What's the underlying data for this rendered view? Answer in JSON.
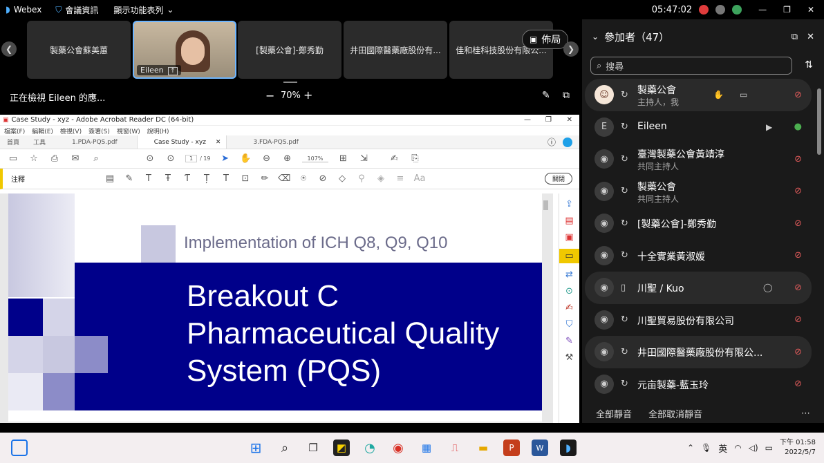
{
  "topbar": {
    "app_name": "Webex",
    "meeting_info": "會議資訊",
    "display_menu": "顯示功能表列",
    "time": "05:47:02"
  },
  "strip": {
    "tiles": [
      {
        "label": "製藥公會蘇美蕙"
      },
      {
        "label": "Eileen",
        "active": true
      },
      {
        "label": "[製藥公會]-鄭秀勤"
      },
      {
        "label": "井田國際醫藥廠股份有..."
      },
      {
        "label": "佳和桂科技股份有限公..."
      }
    ],
    "layout_label": "佈局"
  },
  "viewbar": {
    "status": "正在檢視 Eileen 的應...",
    "zoom": "70%"
  },
  "acrobat": {
    "title": "Case Study - xyz - Adobe Acrobat Reader DC (64-bit)",
    "menu": [
      "檔案(F)",
      "編輯(E)",
      "檢視(V)",
      "簽署(S)",
      "視窗(W)",
      "說明(H)"
    ],
    "tabs": [
      "首頁",
      "工具",
      "1.PDA-PQS.pdf",
      "Case Study - xyz",
      "3.FDA-PQS.pdf"
    ],
    "page_current": "1",
    "page_total": "/ 19",
    "zoom": "107%",
    "comment_label": "注釋",
    "close_label": "關閉"
  },
  "slide": {
    "subtitle": "Implementation of ICH Q8, Q9, Q10",
    "title_lines": [
      "Breakout C",
      "Pharmaceutical Quality",
      "System (PQS)"
    ],
    "colors": {
      "banner": "#00008a",
      "square_light": "#c8c8e0",
      "square_mid": "#8c8cc8"
    }
  },
  "participants": {
    "header": "參加者（47）",
    "search_placeholder": "搜尋",
    "rows": [
      {
        "name": "製藥公會",
        "role": "主持人，我",
        "mic": "muted",
        "highlight": true
      },
      {
        "name": "Eileen",
        "role": "",
        "mic": "on",
        "highlight": false
      },
      {
        "name": "臺灣製藥公會黃靖淳",
        "role": "共同主持人",
        "mic": "muted",
        "highlight": false
      },
      {
        "name": "製藥公會",
        "role": "共同主持人",
        "mic": "muted",
        "highlight": false
      },
      {
        "name": "[製藥公會]-鄭秀勤",
        "role": "",
        "mic": "muted",
        "highlight": false
      },
      {
        "name": "十全實業黃淑媛",
        "role": "",
        "mic": "muted",
        "highlight": false
      },
      {
        "name": "川聖 / Kuo",
        "role": "",
        "mic": "muted",
        "highlight": true
      },
      {
        "name": "川聖貿易股份有限公司",
        "role": "",
        "mic": "muted",
        "highlight": false
      },
      {
        "name": "井田國際醫藥廠股份有限公...",
        "role": "",
        "mic": "muted",
        "highlight": true
      },
      {
        "name": "元亩製藥-藍玉玲",
        "role": "",
        "mic": "muted",
        "highlight": false
      }
    ],
    "mute_all": "全部靜音",
    "unmute_all": "全部取消靜音"
  },
  "taskbar": {
    "ime": "英",
    "time": "下午 01:58",
    "date": "2022/5/7"
  }
}
